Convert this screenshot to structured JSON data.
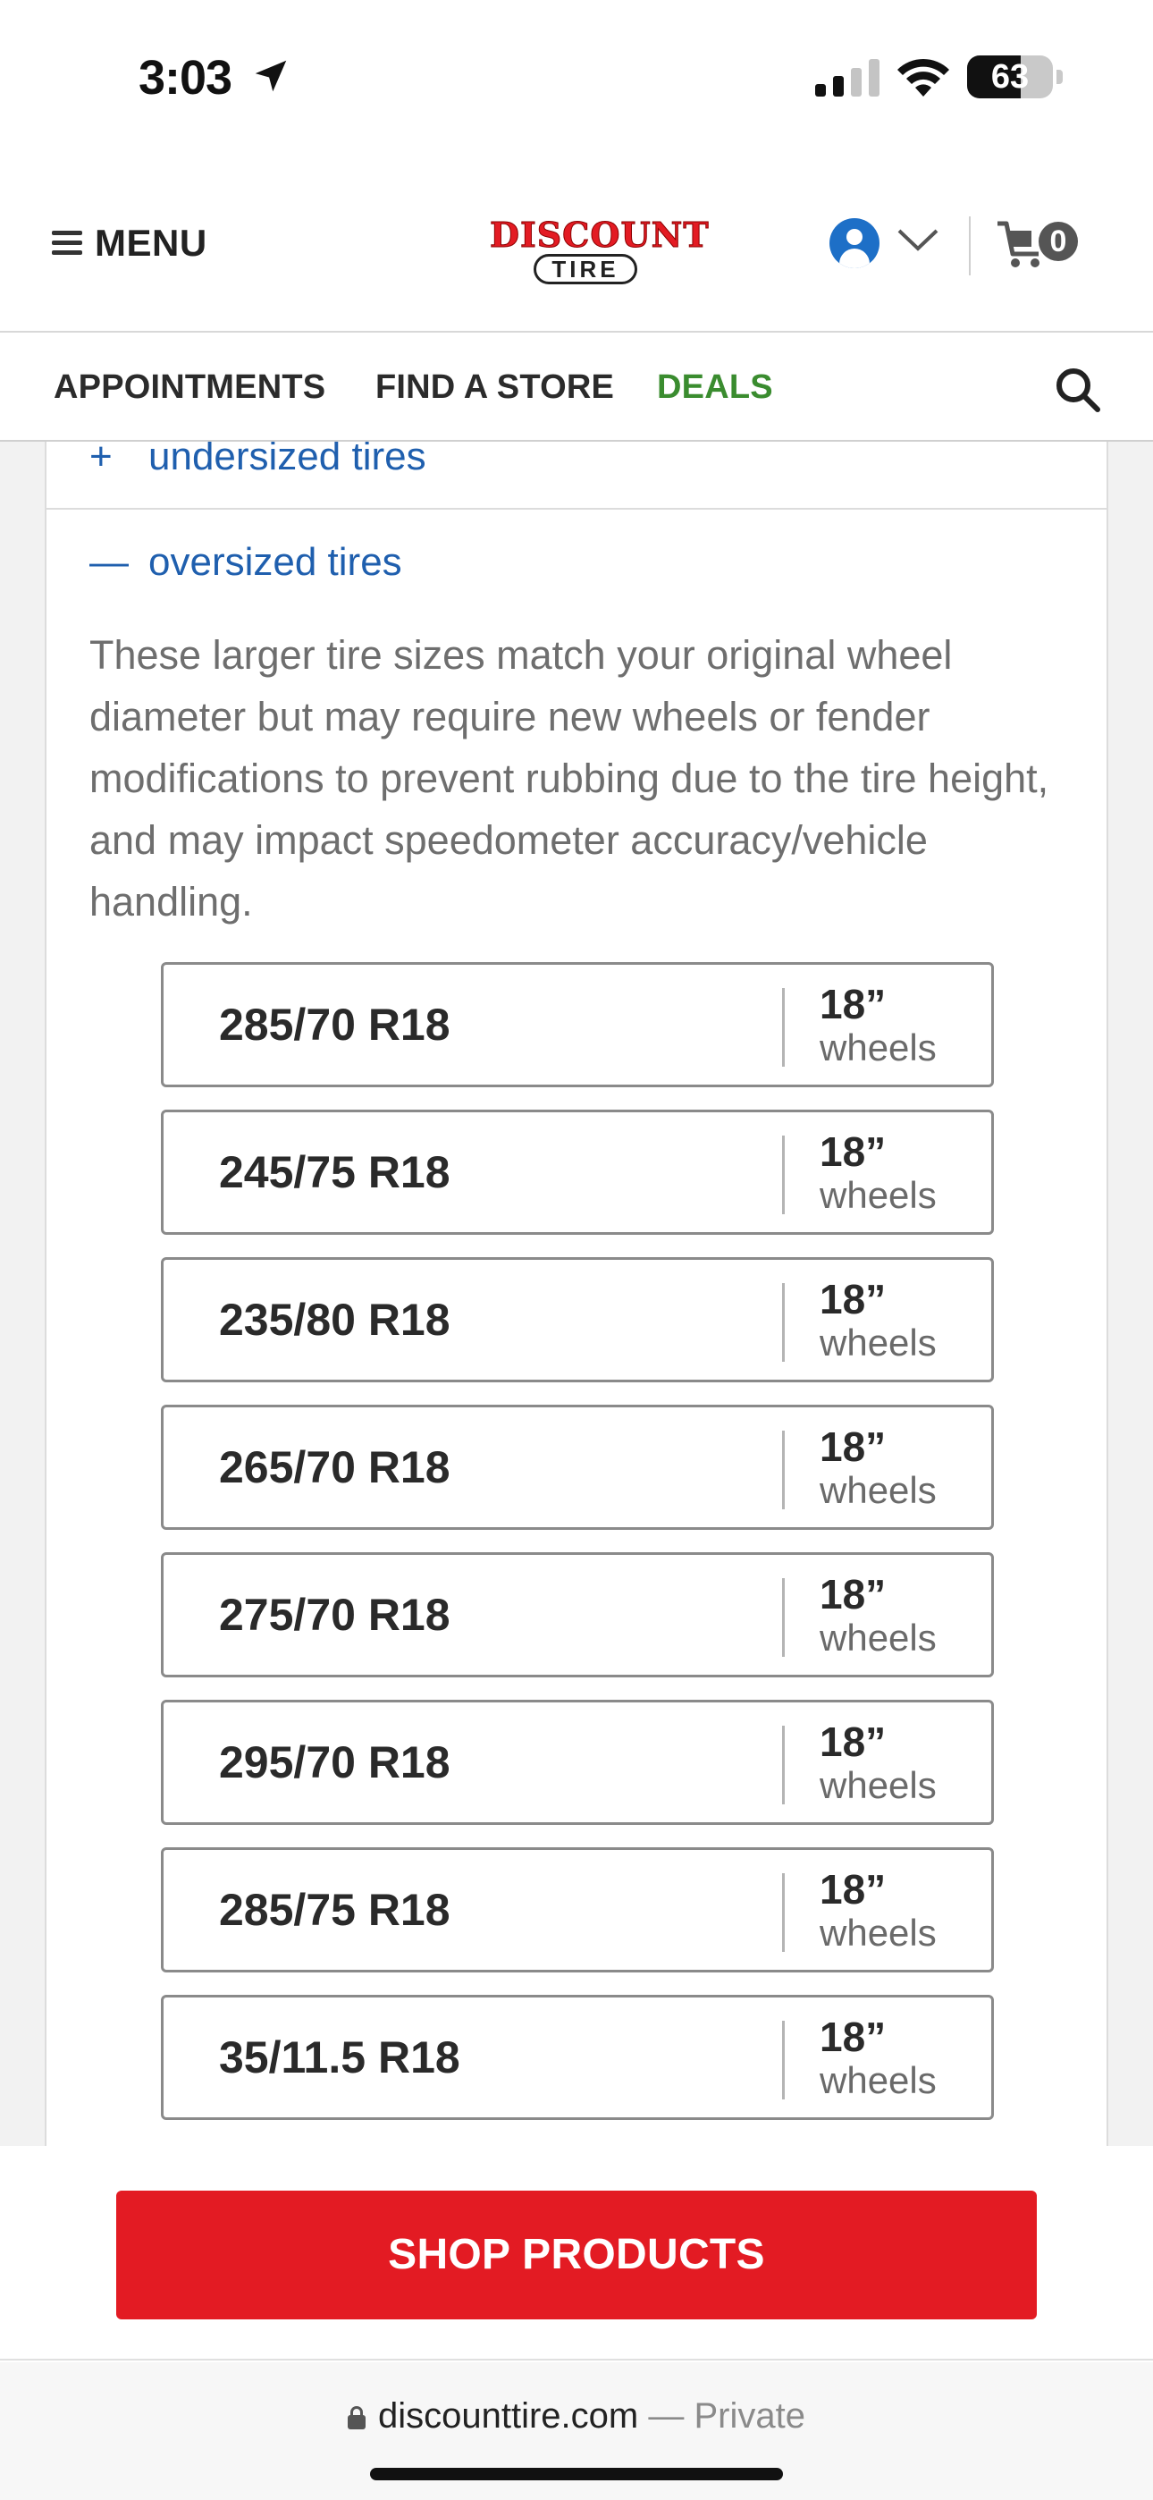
{
  "status_bar": {
    "time": "3:03",
    "battery": "63",
    "battery_level": 0.63
  },
  "header": {
    "menu_label": "MENU",
    "logo_top": "DISCOUNT",
    "logo_bottom": "TIRE",
    "cart_count": "0"
  },
  "nav": {
    "appointments": "APPOINTMENTS",
    "find_store": "FIND A STORE",
    "deals": "DEALS"
  },
  "accordion": {
    "undersized_toggle": "+",
    "undersized_label": "undersized tires",
    "oversized_toggle": "—",
    "oversized_label": "oversized tires",
    "oversized_description": "These larger tire sizes match your original wheel diameter but may require new wheels or fender modifications to prevent rubbing due to the tire height, and may impact speedometer accuracy/vehicle handling."
  },
  "sizes": [
    {
      "size": "285/70 R18",
      "rim": "18”",
      "unit": "wheels"
    },
    {
      "size": "245/75 R18",
      "rim": "18”",
      "unit": "wheels"
    },
    {
      "size": "235/80 R18",
      "rim": "18”",
      "unit": "wheels"
    },
    {
      "size": "265/70 R18",
      "rim": "18”",
      "unit": "wheels"
    },
    {
      "size": "275/70 R18",
      "rim": "18”",
      "unit": "wheels"
    },
    {
      "size": "295/70 R18",
      "rim": "18”",
      "unit": "wheels"
    },
    {
      "size": "285/75 R18",
      "rim": "18”",
      "unit": "wheels"
    },
    {
      "size": "35/11.5 R18",
      "rim": "18”",
      "unit": "wheels"
    }
  ],
  "shop_button": "SHOP PRODUCTS",
  "browser": {
    "domain": "discounttire.com",
    "separator": "—",
    "mode": "Private"
  },
  "icons": {
    "location": "location-arrow-icon",
    "signal": "cellular-signal-icon",
    "wifi": "wifi-icon",
    "menu": "hamburger-icon",
    "account": "user-icon",
    "cart": "cart-icon",
    "search": "search-icon",
    "accessibility": "accessibility-icon",
    "lock": "lock-icon"
  },
  "colors": {
    "brand_red": "#e31b23",
    "link_blue": "#1f5fae",
    "deals_green": "#3a8c2f",
    "account_blue": "#1d6fc7"
  }
}
